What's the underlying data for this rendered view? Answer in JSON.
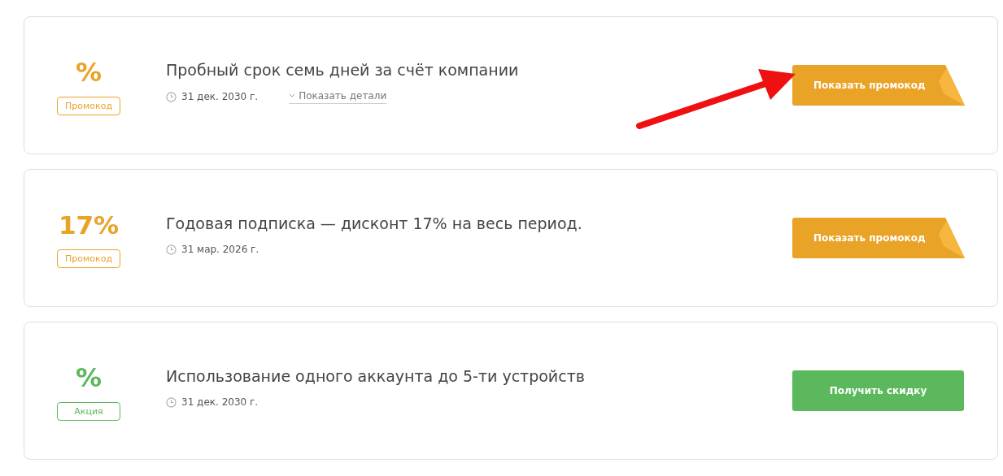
{
  "offers": [
    {
      "kind": "promo",
      "value": "%",
      "tag": "Промокод",
      "title": "Пробный срок семь дней за счёт компании",
      "date": "31 дек. 2030 г.",
      "details_link": "Показать детали",
      "button": "Показать промокод",
      "pointer_arrow": true
    },
    {
      "kind": "promo",
      "value": "17%",
      "tag": "Промокод",
      "title": "Годовая подписка — дисконт 17% на весь период.",
      "date": "31 мар. 2026 г.",
      "button": "Показать промокод",
      "pointer_arrow": false
    },
    {
      "kind": "deal",
      "value": "%",
      "tag": "Акция",
      "title": "Использование одного аккаунта до 5-ти устройств",
      "date": "31 дек. 2030 г.",
      "button": "Получить скидку",
      "pointer_arrow": false
    }
  ]
}
